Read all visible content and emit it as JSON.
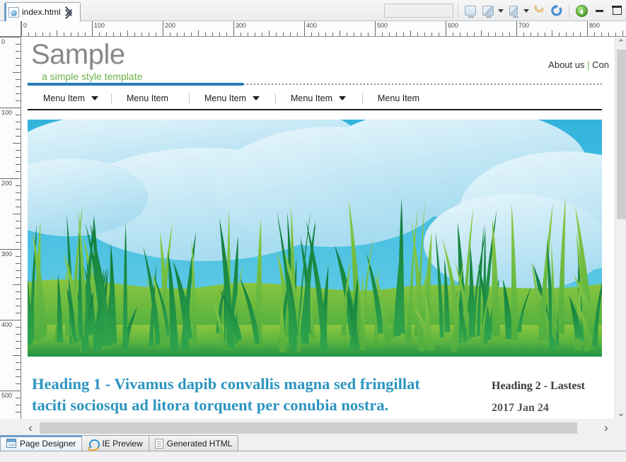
{
  "window": {
    "document_tab": {
      "label": "index.html",
      "icon": "html-document-icon",
      "close_icon": "close-icon"
    },
    "toolbar": {
      "search_value": "",
      "search_placeholder": "",
      "buttons": [
        {
          "name": "preview-monitor-icon",
          "label": ""
        },
        {
          "name": "preview-browser-icon",
          "label": ""
        },
        {
          "name": "preview-browser-dropdown-caret",
          "label": ""
        },
        {
          "name": "preview-device-icon",
          "label": ""
        },
        {
          "name": "preview-device-dropdown-caret",
          "label": ""
        },
        {
          "name": "undo-icon",
          "label": ""
        },
        {
          "name": "refresh-icon",
          "label": ""
        },
        {
          "name": "back-icon",
          "label": ""
        }
      ],
      "minimize_label": "",
      "restore_label": ""
    }
  },
  "rulers": {
    "horizontal_labels": [
      "0",
      "100",
      "200",
      "300",
      "400",
      "500",
      "600",
      "700",
      "800"
    ],
    "vertical_labels": [
      "0",
      "100",
      "200",
      "300",
      "400",
      "500"
    ],
    "unit_step": 100,
    "minor_step": 10
  },
  "page": {
    "site_title": "Sample",
    "site_subtitle": "a simple style template",
    "top_links": {
      "first": "About us",
      "separator": "|",
      "second": "Con"
    },
    "menu_items": [
      {
        "label": "Menu Item",
        "has_dropdown": true
      },
      {
        "label": "Menu Item",
        "has_dropdown": false
      },
      {
        "label": "Menu Item",
        "has_dropdown": true
      },
      {
        "label": "Menu Item",
        "has_dropdown": true
      },
      {
        "label": "Menu Item",
        "has_dropdown": false
      }
    ],
    "banner": {
      "name": "grass-and-sky-banner-image",
      "sky_top_color": "#3bb6dd",
      "sky_bottom_color": "#57c8e3",
      "cloud_color": "#cfeaf6",
      "grass_light": "#7dc242",
      "grass_dark": "#118040"
    },
    "heading1": "Heading 1 - Vivamus dapib convallis magna sed fringillat taciti sociosqu ad litora torquent per conubia nostra.",
    "heading1_color": "#2d95c0",
    "heading2_title": "Heading 2 - Lastest",
    "heading2_date": "2017 Jan 24"
  },
  "scrollbars": {
    "vertical": {
      "up_glyph": "⌃",
      "down_glyph": "⌄"
    },
    "horizontal": {
      "left_glyph": "‹",
      "right_glyph": "›"
    }
  },
  "bottom_tabs": [
    {
      "label": "Page Designer",
      "icon": "page-designer-icon",
      "active": true
    },
    {
      "label": "IE Preview",
      "icon": "internet-explorer-icon",
      "active": false
    },
    {
      "label": "Generated HTML",
      "icon": "html-file-icon",
      "active": false
    }
  ]
}
